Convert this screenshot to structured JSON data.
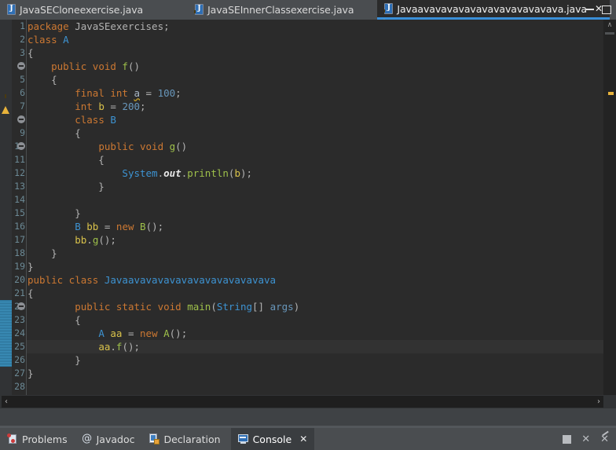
{
  "window": {
    "minimize_label": "minimize",
    "maximize_label": "maximize"
  },
  "editor_tabs": [
    {
      "label": "JavaSECloneexercise.java",
      "icon": "java-file-icon",
      "active": false,
      "warning": false,
      "closable": false
    },
    {
      "label": "JavaSEInnerClassexercise.java",
      "icon": "java-file-warning-icon",
      "active": false,
      "warning": true,
      "closable": false
    },
    {
      "label": "Javaavavavavavavavavavavavava.java",
      "icon": "java-file-warning-icon",
      "active": true,
      "warning": true,
      "closable": true,
      "close_label": "✕"
    }
  ],
  "code": {
    "current_line": 25,
    "total_lines": 28,
    "fold_lines": [
      4,
      8,
      10,
      22
    ],
    "warning_lines": [
      6
    ],
    "change_bar_lines": [
      22,
      23,
      24,
      25,
      26
    ],
    "lines": [
      {
        "n": 1,
        "tokens": [
          {
            "t": "package ",
            "c": "kw"
          },
          {
            "t": "JavaSEexercises",
            "c": "plain"
          },
          {
            "t": ";",
            "c": "plain"
          }
        ]
      },
      {
        "n": 2,
        "tokens": [
          {
            "t": "class ",
            "c": "kw"
          },
          {
            "t": "A",
            "c": "type"
          }
        ]
      },
      {
        "n": 3,
        "tokens": [
          {
            "t": "{",
            "c": "plain"
          }
        ]
      },
      {
        "n": 4,
        "tokens": [
          {
            "t": "    ",
            "c": "plain"
          },
          {
            "t": "public void ",
            "c": "kw"
          },
          {
            "t": "f",
            "c": "meth"
          },
          {
            "t": "()",
            "c": "plain"
          }
        ]
      },
      {
        "n": 5,
        "tokens": [
          {
            "t": "    {",
            "c": "plain"
          }
        ]
      },
      {
        "n": 6,
        "tokens": [
          {
            "t": "        ",
            "c": "plain"
          },
          {
            "t": "final int ",
            "c": "kw"
          },
          {
            "t": "a",
            "c": "warnu"
          },
          {
            "t": " = ",
            "c": "plain"
          },
          {
            "t": "100",
            "c": "num"
          },
          {
            "t": ";",
            "c": "plain"
          }
        ]
      },
      {
        "n": 7,
        "tokens": [
          {
            "t": "        ",
            "c": "plain"
          },
          {
            "t": "int ",
            "c": "kw"
          },
          {
            "t": "b",
            "c": "fld"
          },
          {
            "t": " = ",
            "c": "plain"
          },
          {
            "t": "200",
            "c": "num"
          },
          {
            "t": ";",
            "c": "plain"
          }
        ]
      },
      {
        "n": 8,
        "tokens": [
          {
            "t": "        ",
            "c": "plain"
          },
          {
            "t": "class ",
            "c": "kw"
          },
          {
            "t": "B",
            "c": "type"
          }
        ]
      },
      {
        "n": 9,
        "tokens": [
          {
            "t": "        {",
            "c": "plain"
          }
        ]
      },
      {
        "n": 10,
        "tokens": [
          {
            "t": "            ",
            "c": "plain"
          },
          {
            "t": "public void ",
            "c": "kw"
          },
          {
            "t": "g",
            "c": "meth"
          },
          {
            "t": "()",
            "c": "plain"
          }
        ]
      },
      {
        "n": 11,
        "tokens": [
          {
            "t": "            {",
            "c": "plain"
          }
        ]
      },
      {
        "n": 12,
        "tokens": [
          {
            "t": "                ",
            "c": "plain"
          },
          {
            "t": "System",
            "c": "type"
          },
          {
            "t": ".",
            "c": "plain"
          },
          {
            "t": "out",
            "c": "stat"
          },
          {
            "t": ".",
            "c": "plain"
          },
          {
            "t": "println",
            "c": "meth"
          },
          {
            "t": "(",
            "c": "plain"
          },
          {
            "t": "b",
            "c": "fld"
          },
          {
            "t": ");",
            "c": "plain"
          }
        ]
      },
      {
        "n": 13,
        "tokens": [
          {
            "t": "            }",
            "c": "plain"
          }
        ]
      },
      {
        "n": 14,
        "tokens": [
          {
            "t": "",
            "c": "plain"
          }
        ]
      },
      {
        "n": 15,
        "tokens": [
          {
            "t": "        }",
            "c": "plain"
          }
        ]
      },
      {
        "n": 16,
        "tokens": [
          {
            "t": "        ",
            "c": "plain"
          },
          {
            "t": "B",
            "c": "type"
          },
          {
            "t": " ",
            "c": "plain"
          },
          {
            "t": "bb",
            "c": "fld"
          },
          {
            "t": " = ",
            "c": "plain"
          },
          {
            "t": "new ",
            "c": "kw"
          },
          {
            "t": "B",
            "c": "meth"
          },
          {
            "t": "();",
            "c": "plain"
          }
        ]
      },
      {
        "n": 17,
        "tokens": [
          {
            "t": "        ",
            "c": "plain"
          },
          {
            "t": "bb",
            "c": "fld"
          },
          {
            "t": ".",
            "c": "plain"
          },
          {
            "t": "g",
            "c": "meth"
          },
          {
            "t": "();",
            "c": "plain"
          }
        ]
      },
      {
        "n": 18,
        "tokens": [
          {
            "t": "    }",
            "c": "plain"
          }
        ]
      },
      {
        "n": 19,
        "tokens": [
          {
            "t": "}",
            "c": "plain"
          }
        ]
      },
      {
        "n": 20,
        "tokens": [
          {
            "t": "public class ",
            "c": "kw"
          },
          {
            "t": "Javaavavavavavavavavavavavava",
            "c": "cls"
          }
        ]
      },
      {
        "n": 21,
        "tokens": [
          {
            "t": "{",
            "c": "plain"
          }
        ]
      },
      {
        "n": 22,
        "tokens": [
          {
            "t": "        ",
            "c": "plain"
          },
          {
            "t": "public static void ",
            "c": "kw"
          },
          {
            "t": "main",
            "c": "meth"
          },
          {
            "t": "(",
            "c": "plain"
          },
          {
            "t": "String",
            "c": "type"
          },
          {
            "t": "[] ",
            "c": "plain"
          },
          {
            "t": "args",
            "c": "num"
          },
          {
            "t": ")",
            "c": "plain"
          }
        ]
      },
      {
        "n": 23,
        "tokens": [
          {
            "t": "        {",
            "c": "plain"
          }
        ]
      },
      {
        "n": 24,
        "tokens": [
          {
            "t": "            ",
            "c": "plain"
          },
          {
            "t": "A",
            "c": "type"
          },
          {
            "t": " ",
            "c": "plain"
          },
          {
            "t": "aa",
            "c": "fld"
          },
          {
            "t": " = ",
            "c": "plain"
          },
          {
            "t": "new ",
            "c": "kw"
          },
          {
            "t": "A",
            "c": "meth"
          },
          {
            "t": "();",
            "c": "plain"
          }
        ]
      },
      {
        "n": 25,
        "tokens": [
          {
            "t": "            ",
            "c": "plain"
          },
          {
            "t": "aa",
            "c": "fld"
          },
          {
            "t": ".",
            "c": "plain"
          },
          {
            "t": "f",
            "c": "meth"
          },
          {
            "t": "();",
            "c": "plain"
          }
        ]
      },
      {
        "n": 26,
        "tokens": [
          {
            "t": "        }",
            "c": "plain"
          }
        ]
      },
      {
        "n": 27,
        "tokens": [
          {
            "t": "}",
            "c": "plain"
          }
        ]
      },
      {
        "n": 28,
        "tokens": [
          {
            "t": "",
            "c": "plain"
          }
        ]
      }
    ]
  },
  "scrollbars": {
    "vertical_up_arrow": "∧",
    "vertical_down_arrow": "∨",
    "horizontal_left_arrow": "‹",
    "horizontal_right_arrow": "›"
  },
  "view_tabs": [
    {
      "label": "Problems",
      "icon": "problems-icon",
      "active": false,
      "closable": false
    },
    {
      "label": "Javadoc",
      "icon": "javadoc-icon",
      "active": false,
      "closable": false
    },
    {
      "label": "Declaration",
      "icon": "declaration-icon",
      "active": false,
      "closable": false
    },
    {
      "label": "Console",
      "icon": "console-icon",
      "active": true,
      "closable": true,
      "close_label": "✕"
    }
  ],
  "view_tools": {
    "stop_label": "stop",
    "close_label": "✕",
    "close_all_label": "✕"
  },
  "colors": {
    "tab_active_bg": "#2b2b2b",
    "tab_active_underline": "#3a8fd8",
    "editor_bg": "#2b2b2b",
    "gutter_bg": "#313335",
    "current_line_bg": "#323232",
    "keyword": "#cc7832",
    "type": "#3d93d2",
    "method": "#9ec04a",
    "field": "#d9c24b",
    "number": "#6897bb",
    "text": "#a9b7c6",
    "line_number": "#6c8a96",
    "warning": "#e8b33b",
    "change_bar": "#3e94c0"
  }
}
